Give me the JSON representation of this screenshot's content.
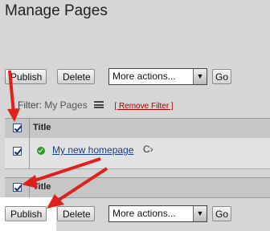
{
  "page": {
    "title": "Manage Pages"
  },
  "top_toolbar": {
    "publish_label": "Publish",
    "delete_label": "Delete",
    "more_actions_value": "More actions...",
    "go_label": "Go"
  },
  "filter": {
    "label": "Filter:",
    "value": "My Pages",
    "remove_label": "[ Remove Filter ]"
  },
  "table": {
    "header_title": "Title",
    "footer_title": "Title",
    "rows": [
      {
        "title": "My new homepage",
        "status": "published"
      }
    ]
  },
  "bottom_toolbar": {
    "publish_label": "Publish",
    "delete_label": "Delete",
    "more_actions_value": "More actions...",
    "go_label": "Go"
  },
  "colors": {
    "annotation_arrow": "#e0201c",
    "link": "#1a3d8a",
    "remove_filter": "#a40000",
    "status_published": "#2a9a2a"
  }
}
